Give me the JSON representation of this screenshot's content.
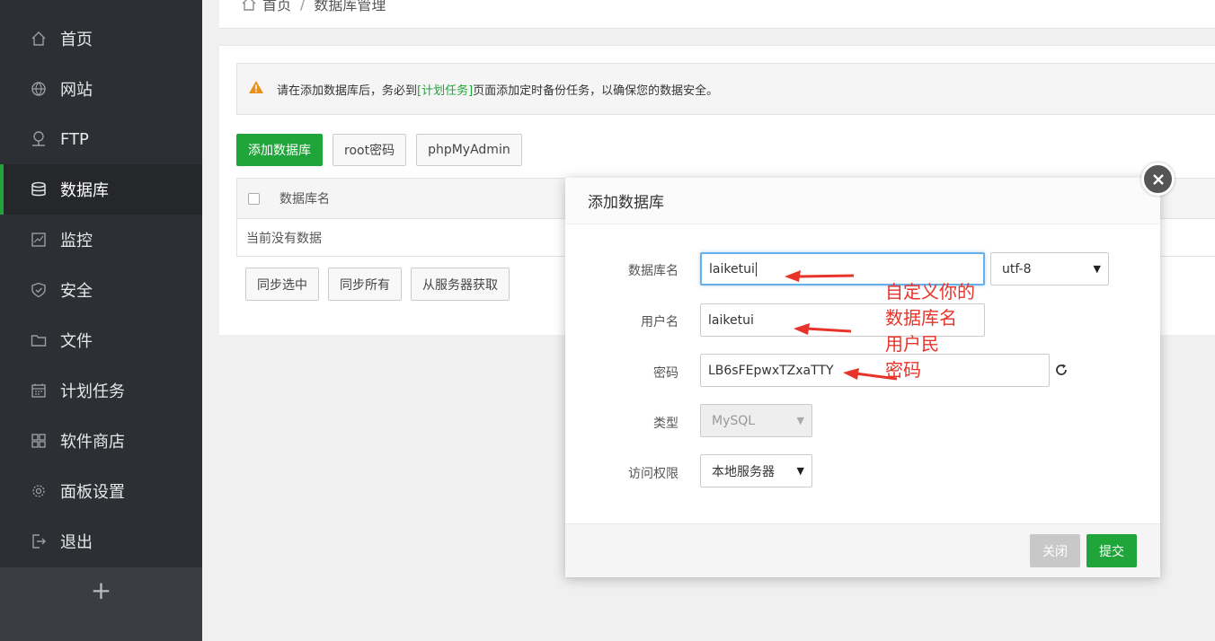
{
  "sidebar": {
    "items": [
      {
        "label": "首页",
        "icon": "home-icon"
      },
      {
        "label": "网站",
        "icon": "globe-icon"
      },
      {
        "label": "FTP",
        "icon": "ftp-icon"
      },
      {
        "label": "数据库",
        "icon": "database-icon"
      },
      {
        "label": "监控",
        "icon": "monitor-icon"
      },
      {
        "label": "安全",
        "icon": "shield-icon"
      },
      {
        "label": "文件",
        "icon": "folder-icon"
      },
      {
        "label": "计划任务",
        "icon": "calendar-icon"
      },
      {
        "label": "软件商店",
        "icon": "apps-icon"
      },
      {
        "label": "面板设置",
        "icon": "gear-icon"
      },
      {
        "label": "退出",
        "icon": "logout-icon"
      }
    ],
    "active_index": 3,
    "add_label": "+"
  },
  "breadcrumb": {
    "home": "首页",
    "sep": "/",
    "current": "数据库管理"
  },
  "alert": {
    "pre": "请在添加数据库后，务必到",
    "link": "[计划任务]",
    "post": "页面添加定时备份任务，以确保您的数据安全。"
  },
  "toolbar": {
    "add_db": "添加数据库",
    "root_pwd": "root密码",
    "phpmyadmin": "phpMyAdmin"
  },
  "table": {
    "col_name": "数据库名",
    "empty": "当前没有数据"
  },
  "bottom_buttons": {
    "sync_selected": "同步选中",
    "sync_all": "同步所有",
    "fetch_server": "从服务器获取"
  },
  "modal": {
    "title": "添加数据库",
    "db_name_label": "数据库名",
    "db_name_value": "laiketui",
    "charset_value": "utf-8",
    "user_label": "用户名",
    "user_value": "laiketui",
    "pwd_label": "密码",
    "pwd_value": "LB6sFEpwxTZxaTTY",
    "type_label": "类型",
    "type_value": "MySQL",
    "access_label": "访问权限",
    "access_value": "本地服务器",
    "close_btn": "关闭",
    "submit_btn": "提交"
  },
  "annotation": {
    "lines": [
      "自定义你的",
      "数据库名",
      "用户民",
      "密码"
    ]
  },
  "colors": {
    "brand_green": "#20a53a",
    "annotation_red": "#e8332a",
    "sidebar_bg": "#2c2f33"
  }
}
